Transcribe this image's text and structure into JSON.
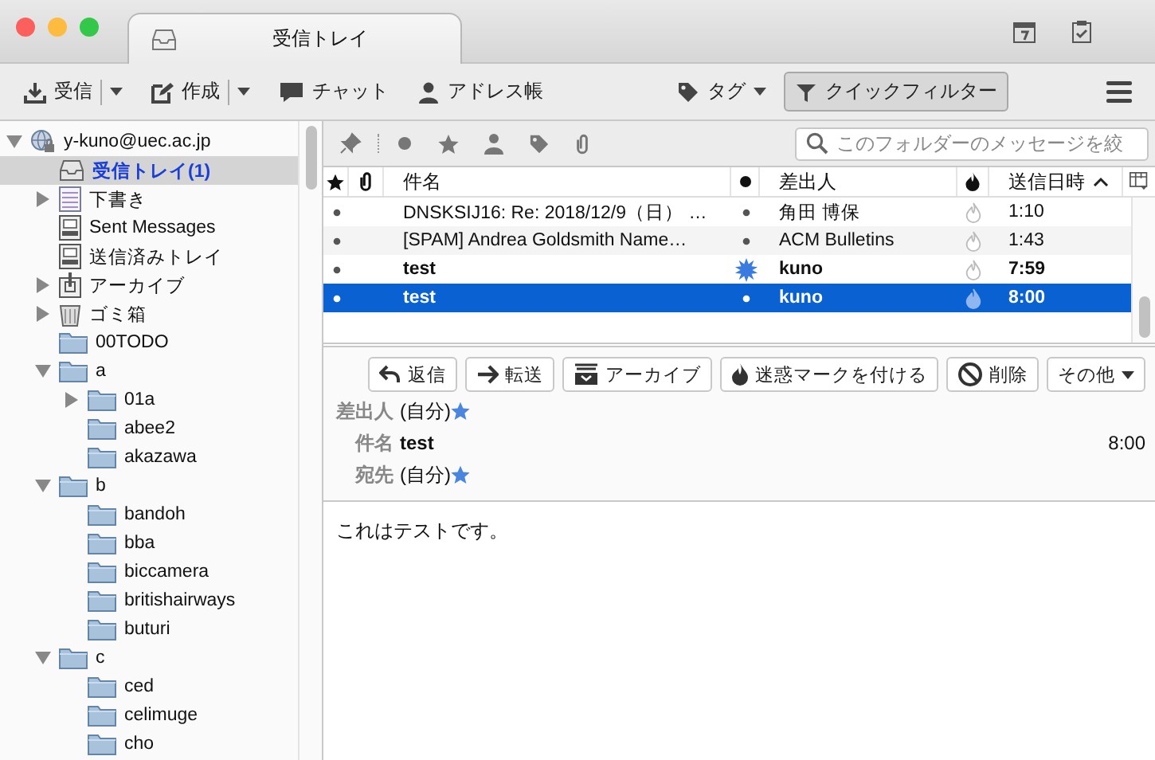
{
  "window": {
    "tab": {
      "title": "受信トレイ",
      "selected": true
    }
  },
  "toolbar": [
    {
      "kind": "get",
      "label": "受信",
      "split": true,
      "dropdown": true,
      "pressed": false
    },
    {
      "kind": "write",
      "label": "作成",
      "split": true,
      "dropdown": true,
      "pressed": false
    },
    {
      "kind": "chat",
      "label": "チャット",
      "split": false,
      "dropdown": false,
      "pressed": false
    },
    {
      "kind": "contacts",
      "label": "アドレス帳",
      "split": false,
      "dropdown": false,
      "pressed": false
    },
    {
      "kind": "tag",
      "label": "タグ",
      "split": false,
      "dropdown": true,
      "pressed": false
    },
    {
      "kind": "filter",
      "label": "クイックフィルター",
      "split": false,
      "dropdown": false,
      "pressed": true
    }
  ],
  "folders": [
    {
      "kind": "account",
      "name": "y-kuno@uec.ac.jp",
      "expanded": true,
      "selected": false,
      "children": [
        {
          "kind": "inbox",
          "name": "受信トレイ",
          "count": "(1)",
          "selected": true
        },
        {
          "kind": "drafts",
          "name": "下書き",
          "expanded": false,
          "selected": false
        },
        {
          "kind": "sent",
          "name": "Sent Messages",
          "selected": false
        },
        {
          "kind": "sent",
          "name": "送信済みトレイ",
          "selected": false
        },
        {
          "kind": "archive",
          "name": "アーカイブ",
          "expanded": false,
          "selected": false
        },
        {
          "kind": "trash",
          "name": "ゴミ箱",
          "expanded": false,
          "selected": false
        },
        {
          "kind": "folder",
          "name": "00TODO",
          "selected": false
        },
        {
          "kind": "folder",
          "name": "a",
          "expanded": true,
          "selected": false,
          "children": [
            {
              "kind": "folder",
              "name": "01a",
              "expanded": false,
              "selected": false
            },
            {
              "kind": "folder",
              "name": "abee2",
              "selected": false
            },
            {
              "kind": "folder",
              "name": "akazawa",
              "selected": false
            }
          ]
        },
        {
          "kind": "folder",
          "name": "b",
          "expanded": true,
          "selected": false,
          "children": [
            {
              "kind": "folder",
              "name": "bandoh",
              "selected": false
            },
            {
              "kind": "folder",
              "name": "bba",
              "selected": false
            },
            {
              "kind": "folder",
              "name": "biccamera",
              "selected": false
            },
            {
              "kind": "folder",
              "name": "britishairways",
              "selected": false
            },
            {
              "kind": "folder",
              "name": "buturi",
              "selected": false
            }
          ]
        },
        {
          "kind": "folder",
          "name": "c",
          "expanded": true,
          "selected": false,
          "children": [
            {
              "kind": "folder",
              "name": "ced",
              "selected": false
            },
            {
              "kind": "folder",
              "name": "celimuge",
              "selected": false
            },
            {
              "kind": "folder",
              "name": "cho",
              "selected": false
            }
          ]
        }
      ]
    }
  ],
  "quick_filter": {
    "toggles": [
      {
        "kind": "pin",
        "on": false
      },
      {
        "kind": "unread",
        "on": false
      },
      {
        "kind": "starred",
        "on": false
      },
      {
        "kind": "contact",
        "on": false
      },
      {
        "kind": "tags",
        "on": false
      },
      {
        "kind": "attachment",
        "on": false
      }
    ],
    "search": {
      "placeholder": "このフォルダーのメッセージを絞"
    }
  },
  "message_list": {
    "columns": [
      {
        "kind": "star",
        "sorted": false
      },
      {
        "kind": "attachment",
        "sorted": false
      },
      {
        "kind": "subject",
        "label": "件名",
        "sorted": false
      },
      {
        "kind": "read",
        "sorted": false
      },
      {
        "kind": "sender",
        "label": "差出人",
        "sorted": false
      },
      {
        "kind": "junk",
        "sorted": false
      },
      {
        "kind": "date",
        "label": "送信日時",
        "sorted": true
      }
    ],
    "rows": [
      {
        "starred": false,
        "subject": "DNSKSIJ16: Re: 2018/12/9（日） …",
        "new": false,
        "sender": "角田 博保",
        "date": "1:10",
        "unread": false,
        "selected": false
      },
      {
        "starred": false,
        "subject": "[SPAM] Andrea Goldsmith Name…",
        "new": false,
        "sender": "ACM Bulletins",
        "date": "1:43",
        "unread": false,
        "selected": false
      },
      {
        "starred": false,
        "subject": "test",
        "new": true,
        "sender": "kuno",
        "date": "7:59",
        "unread": true,
        "selected": false
      },
      {
        "starred": false,
        "subject": "test",
        "new": false,
        "sender": "kuno",
        "date": "8:00",
        "unread": true,
        "selected": true
      }
    ]
  },
  "message_header": {
    "buttons": [
      {
        "kind": "reply",
        "label": "返信",
        "dropdown": false
      },
      {
        "kind": "forward",
        "label": "転送",
        "dropdown": false
      },
      {
        "kind": "archive",
        "label": "アーカイブ",
        "dropdown": false
      },
      {
        "kind": "junk",
        "label": "迷惑マークを付ける",
        "dropdown": false
      },
      {
        "kind": "delete",
        "label": "削除",
        "dropdown": false
      },
      {
        "kind": "more",
        "label": "その他",
        "dropdown": true
      }
    ],
    "fields": [
      {
        "label": "差出人",
        "value": "(自分)",
        "contact": true,
        "bold": false
      },
      {
        "label": "件名",
        "value": "test",
        "contact": false,
        "bold": true
      },
      {
        "label": "宛先",
        "value": "(自分)",
        "contact": true,
        "bold": false
      }
    ],
    "date": "8:00"
  },
  "body": "これはテストです。"
}
